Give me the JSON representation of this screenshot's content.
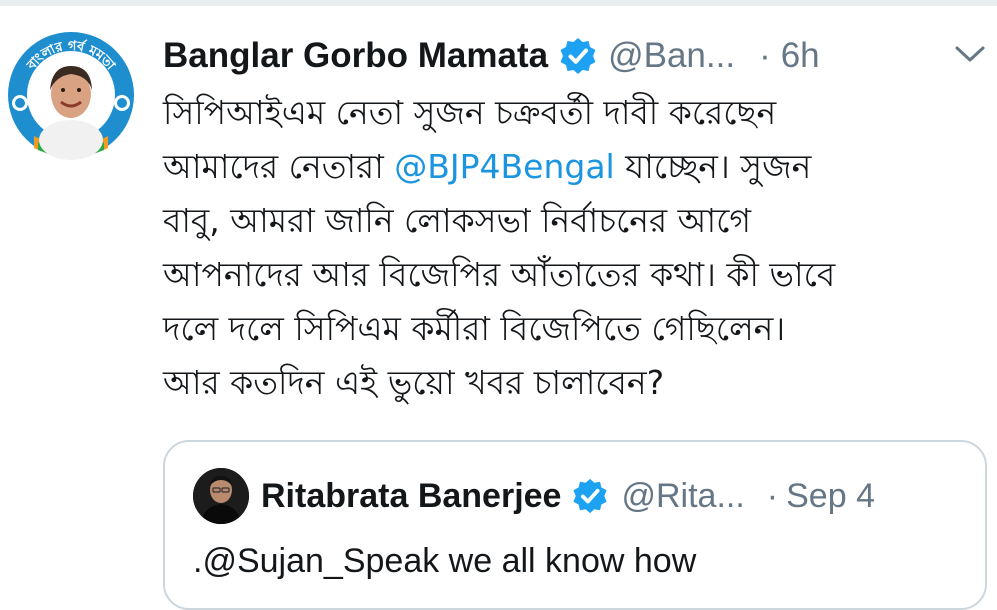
{
  "tweet": {
    "author_name": "Banglar Gorbo Mamata",
    "author_handle": "@Ban...",
    "separator": "·",
    "time": "6h",
    "avatar_badge_text": "বাংলার গর্ব মমতা",
    "body_lines": [
      {
        "pre": "সিপিআইএম নেতা সুজন চক্রবর্তী দাবী করেছেন",
        "mention": "",
        "post": ""
      },
      {
        "pre": "আমাদের নেতারা ",
        "mention": "@BJP4Bengal",
        "post": " যাচ্ছেন। সুজন"
      },
      {
        "pre": "বাবু, আমরা জানি লোকসভা নির্বাচনের আগে",
        "mention": "",
        "post": ""
      },
      {
        "pre": "আপনাদের আর বিজেপির আঁতাতের কথা। কী ভাবে",
        "mention": "",
        "post": ""
      },
      {
        "pre": "দলে দলে সিপিএম কর্মীরা বিজেপিতে গেছিলেন।",
        "mention": "",
        "post": ""
      },
      {
        "pre": "আর কতদিন এই ভুয়ো খবর চালাবেন?",
        "mention": "",
        "post": ""
      }
    ]
  },
  "quoted": {
    "author_name": "Ritabrata Banerjee",
    "author_handle": "@Rita...",
    "separator": "·",
    "time": "Sep 4",
    "text": ".@Sujan_Speak we all know how"
  },
  "icons": {
    "verified": "verified-badge-icon",
    "menu": "chevron-down-icon"
  },
  "colors": {
    "verified_blue": "#1da1f2",
    "mention_blue": "#1b95e0",
    "muted_gray": "#657786",
    "border": "#ccd6dd"
  }
}
